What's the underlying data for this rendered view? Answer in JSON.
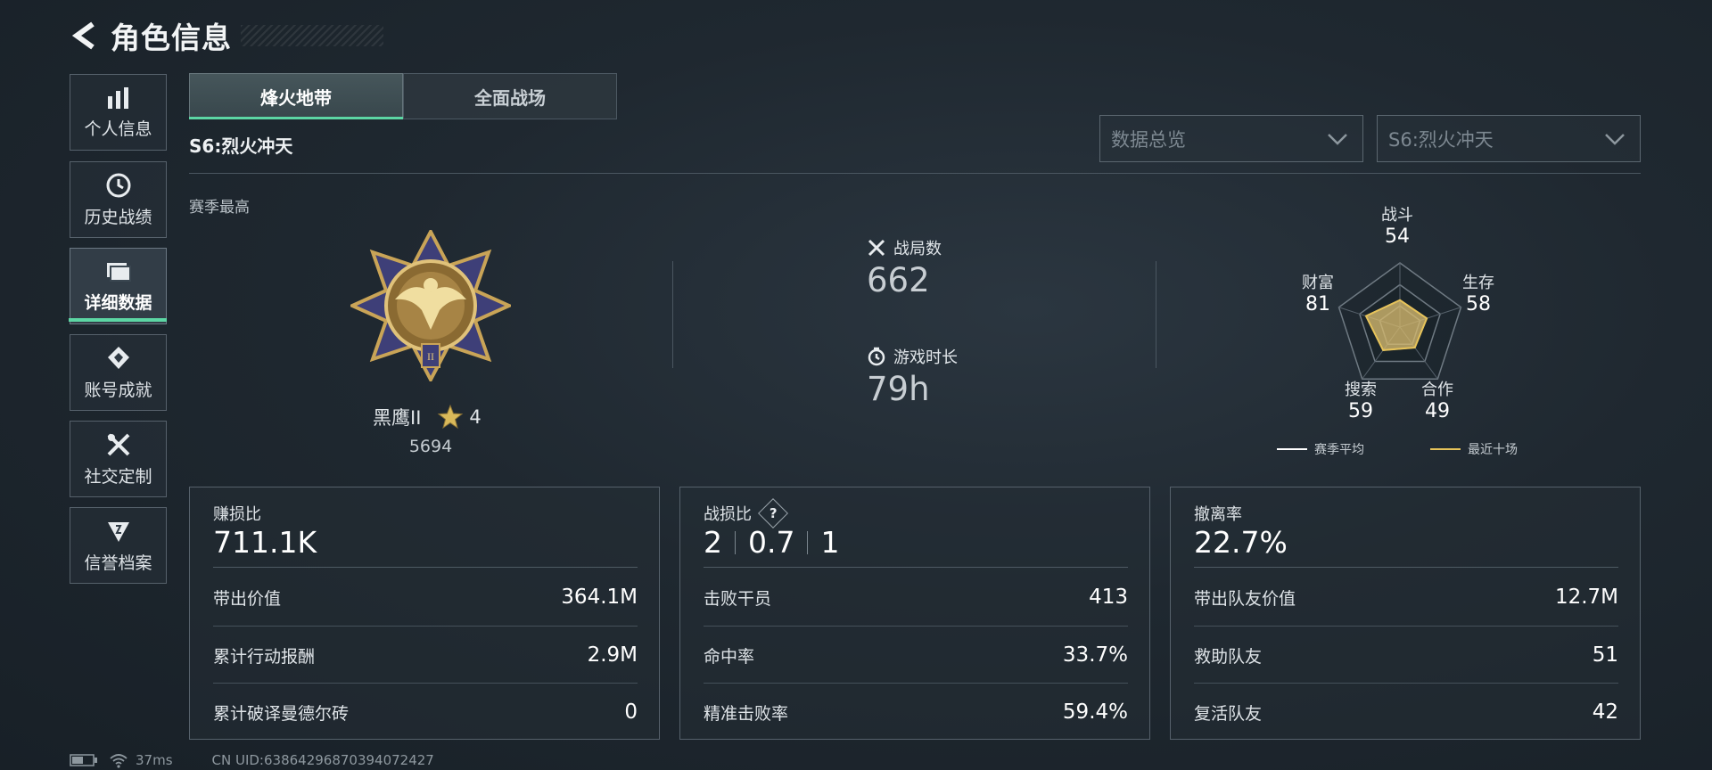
{
  "header": {
    "title": "角色信息"
  },
  "sidebar": {
    "items": [
      {
        "label": "个人信息",
        "icon": "bar-chart-icon"
      },
      {
        "label": "历史战绩",
        "icon": "clock-icon"
      },
      {
        "label": "详细数据",
        "icon": "folder-icon",
        "active": true
      },
      {
        "label": "账号成就",
        "icon": "badge-icon"
      },
      {
        "label": "社交定制",
        "icon": "tools-icon"
      },
      {
        "label": "信誉档案",
        "icon": "shield-icon"
      }
    ]
  },
  "mode_tabs": [
    {
      "label": "烽火地带",
      "active": true
    },
    {
      "label": "全面战场",
      "active": false
    }
  ],
  "season_label": "S6:烈火冲天",
  "dropdowns": {
    "overview": "数据总览",
    "season": "S6:烈火冲天"
  },
  "best": {
    "label": "赛季最高",
    "rank_name": "黑鹰II",
    "stars": "4",
    "points": "5694"
  },
  "stats": {
    "matches_label": "战局数",
    "matches_value": "662",
    "playtime_label": "游戏时长",
    "playtime_value": "79h"
  },
  "radar": {
    "axes": [
      {
        "label": "战斗",
        "value": "54"
      },
      {
        "label": "生存",
        "value": "58"
      },
      {
        "label": "合作",
        "value": "49"
      },
      {
        "label": "搜索",
        "value": "59"
      },
      {
        "label": "财富",
        "value": "81"
      }
    ],
    "legend_season": "赛季平均",
    "legend_recent": "最近十场",
    "season_color": "#ffffff",
    "recent_color": "#e6c35a"
  },
  "cards": {
    "profit": {
      "title": "赚损比",
      "main": "711.1K",
      "rows": [
        {
          "label": "带出价值",
          "value": "364.1M"
        },
        {
          "label": "累计行动报酬",
          "value": "2.9M"
        },
        {
          "label": "累计破译曼德尔砖",
          "value": "0"
        }
      ]
    },
    "kd": {
      "title": "战损比",
      "help": "?",
      "kills": "2",
      "ratio": "0.7",
      "deaths": "1",
      "rows": [
        {
          "label": "击败干员",
          "value": "413"
        },
        {
          "label": "命中率",
          "value": "33.7%"
        },
        {
          "label": "精准击败率",
          "value": "59.4%"
        }
      ]
    },
    "extract": {
      "title": "撤离率",
      "main": "22.7%",
      "rows": [
        {
          "label": "带出队友价值",
          "value": "12.7M"
        },
        {
          "label": "救助队友",
          "value": "51"
        },
        {
          "label": "复活队友",
          "value": "42"
        }
      ]
    }
  },
  "footer": {
    "ping": "37ms",
    "uid": "CN UID:638642968703940724​27"
  }
}
